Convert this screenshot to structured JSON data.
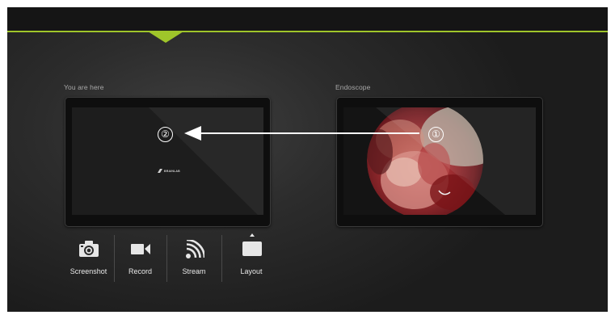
{
  "left_panel": {
    "caption": "You are here",
    "badge": "②",
    "logo_text": "BRAINLAB"
  },
  "right_panel": {
    "caption": "Endoscope",
    "badge": "①"
  },
  "toolbar": {
    "screenshot_label": "Screenshot",
    "record_label": "Record",
    "stream_label": "Stream",
    "layout_label": "Layout"
  },
  "colors": {
    "accent": "#9fc52a",
    "background": "#2b2b2b",
    "text": "#e8e8e8"
  },
  "icons": [
    "chevron-down-icon",
    "camera-icon",
    "video-camera-icon",
    "stream-icon",
    "layout-icon",
    "arrow-left-icon"
  ]
}
